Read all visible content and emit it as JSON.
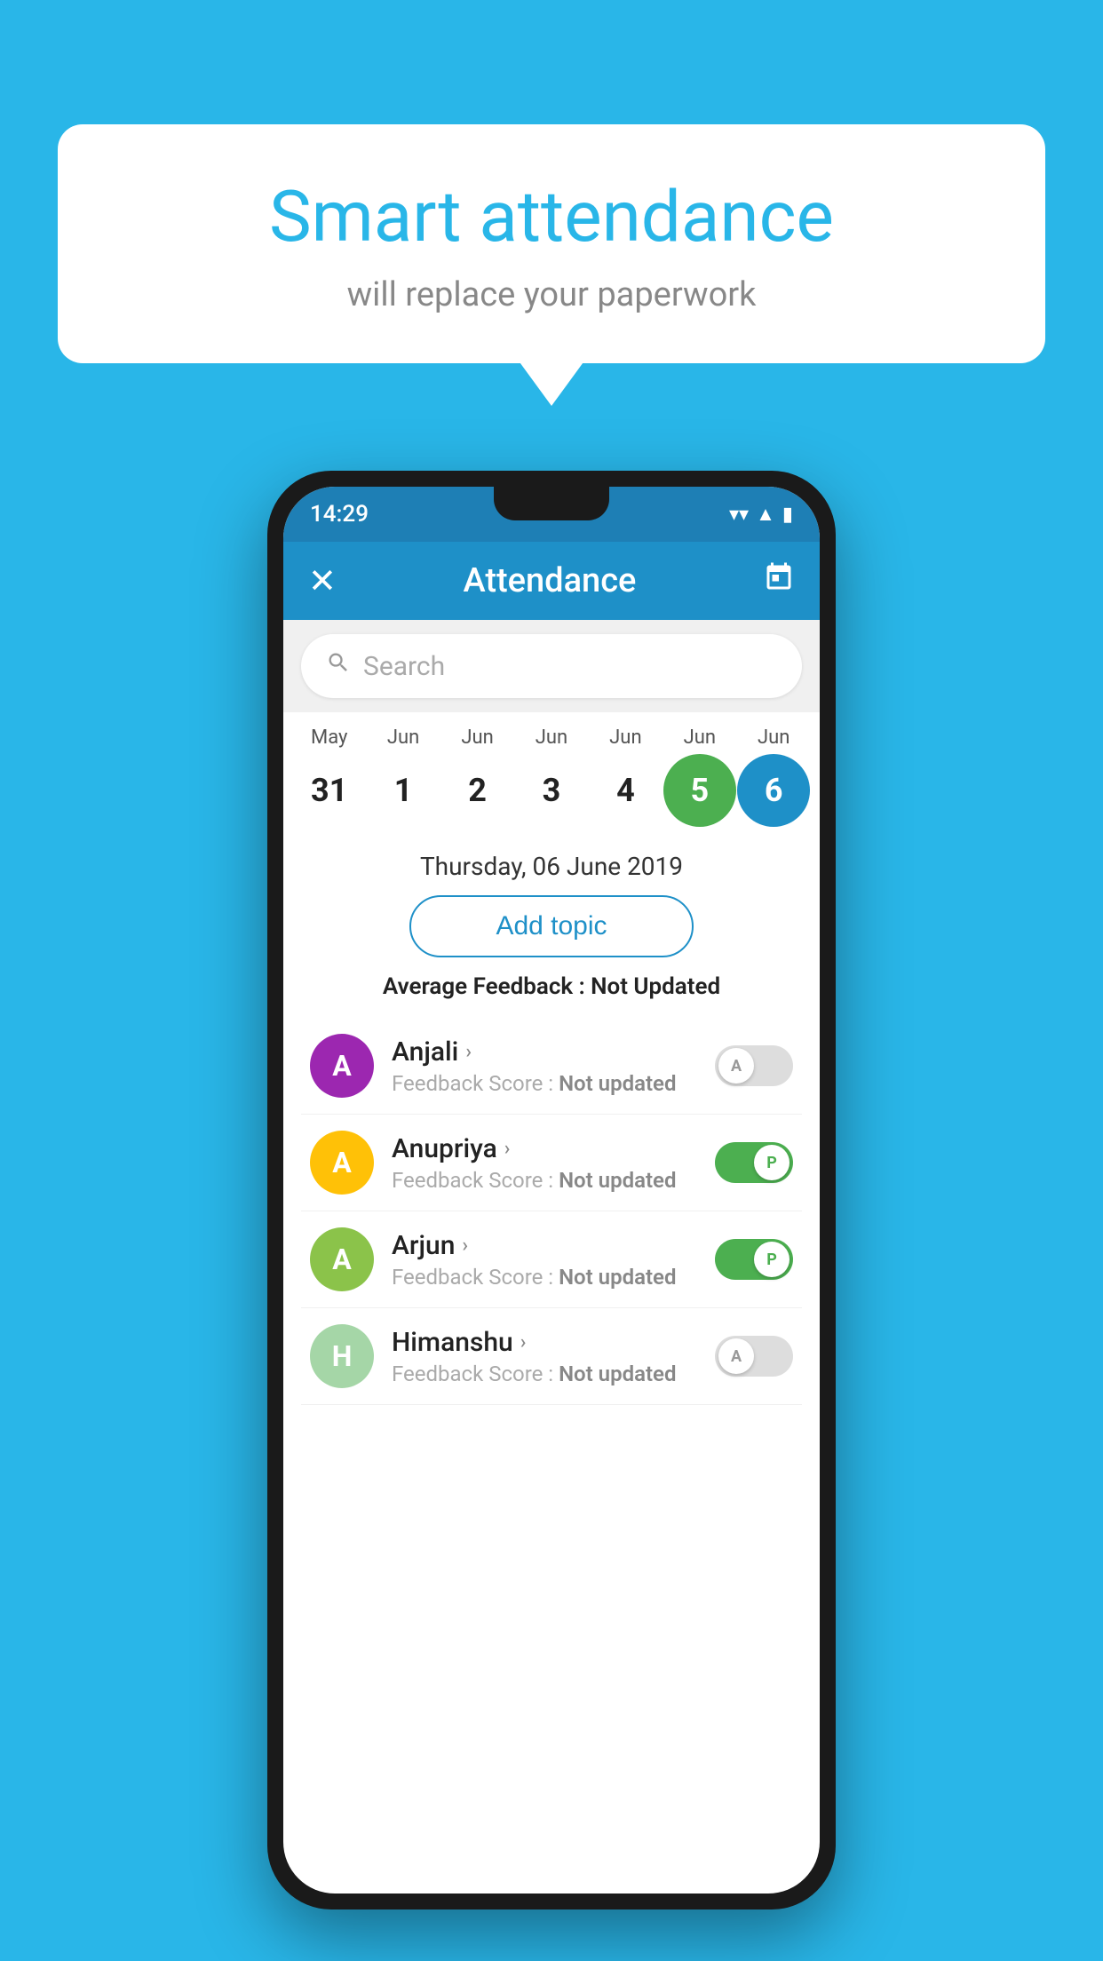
{
  "background_color": "#29b6e8",
  "bubble": {
    "title": "Smart attendance",
    "subtitle": "will replace your paperwork"
  },
  "status_bar": {
    "time": "14:29",
    "wifi": "▼",
    "signal": "▲",
    "battery": "■"
  },
  "app_bar": {
    "title": "Attendance",
    "close_label": "✕",
    "calendar_label": "📅"
  },
  "search": {
    "placeholder": "Search"
  },
  "calendar": {
    "months": [
      "May",
      "Jun",
      "Jun",
      "Jun",
      "Jun",
      "Jun",
      "Jun"
    ],
    "dates": [
      "31",
      "1",
      "2",
      "3",
      "4",
      "5",
      "6"
    ],
    "today_index": 5,
    "selected_index": 6
  },
  "selected_date_label": "Thursday, 06 June 2019",
  "add_topic_label": "Add topic",
  "avg_feedback_label": "Average Feedback : ",
  "avg_feedback_value": "Not Updated",
  "students": [
    {
      "name": "Anjali",
      "avatar_letter": "A",
      "avatar_color": "#9c27b0",
      "feedback_label": "Feedback Score : ",
      "feedback_value": "Not updated",
      "status": "absent"
    },
    {
      "name": "Anupriya",
      "avatar_letter": "A",
      "avatar_color": "#ffc107",
      "feedback_label": "Feedback Score : ",
      "feedback_value": "Not updated",
      "status": "present"
    },
    {
      "name": "Arjun",
      "avatar_letter": "A",
      "avatar_color": "#8bc34a",
      "feedback_label": "Feedback Score : ",
      "feedback_value": "Not updated",
      "status": "present"
    },
    {
      "name": "Himanshu",
      "avatar_letter": "H",
      "avatar_color": "#a5d6a7",
      "feedback_label": "Feedback Score : ",
      "feedback_value": "Not updated",
      "status": "absent"
    }
  ]
}
